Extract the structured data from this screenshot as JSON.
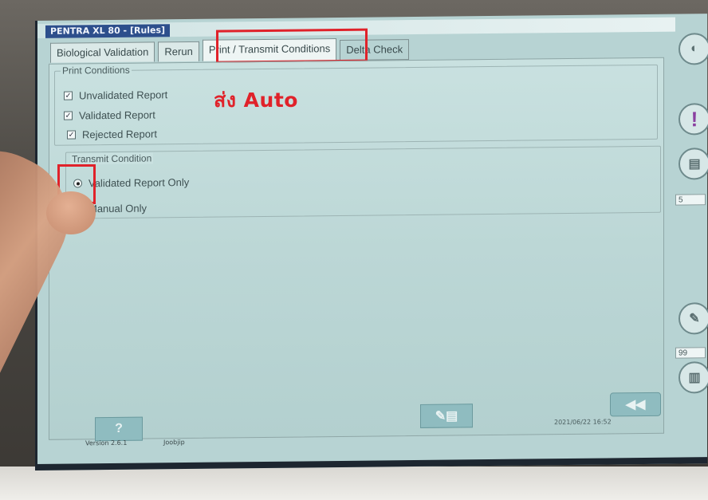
{
  "window": {
    "title": "PENTRA XL 80  - [Rules]"
  },
  "tabs": [
    {
      "label": "Biological Validation"
    },
    {
      "label": "Rerun"
    },
    {
      "label": "Print / Transmit Conditions",
      "active": true
    },
    {
      "label": "Delta Check"
    }
  ],
  "print_conditions": {
    "label": "Print Conditions",
    "options": [
      {
        "label": "Unvalidated Report",
        "checked": true
      },
      {
        "label": "Validated Report",
        "checked": true
      },
      {
        "label": "Rejected Report",
        "checked": true
      }
    ]
  },
  "transmit_condition": {
    "label": "Transmit Condition",
    "options": [
      {
        "label": "Validated Report Only",
        "selected": true
      },
      {
        "label": "Manual Only",
        "selected": false
      }
    ]
  },
  "annotation": {
    "text": "ส่ง Auto",
    "color": "#e0222a"
  },
  "right_toolbar": {
    "field_top": "5",
    "field_bottom": "99",
    "icons": [
      "logo-icon",
      "alert-icon",
      "rules-icon",
      "edit-icon",
      "rack-icon"
    ]
  },
  "bottom_toolbar": {
    "icons": [
      "help-icon",
      "report-icon",
      "back-icon"
    ]
  },
  "status": {
    "version": "Version 2.6.1",
    "user": "Joobjip",
    "datetime": "2021/06/22 16:52"
  }
}
